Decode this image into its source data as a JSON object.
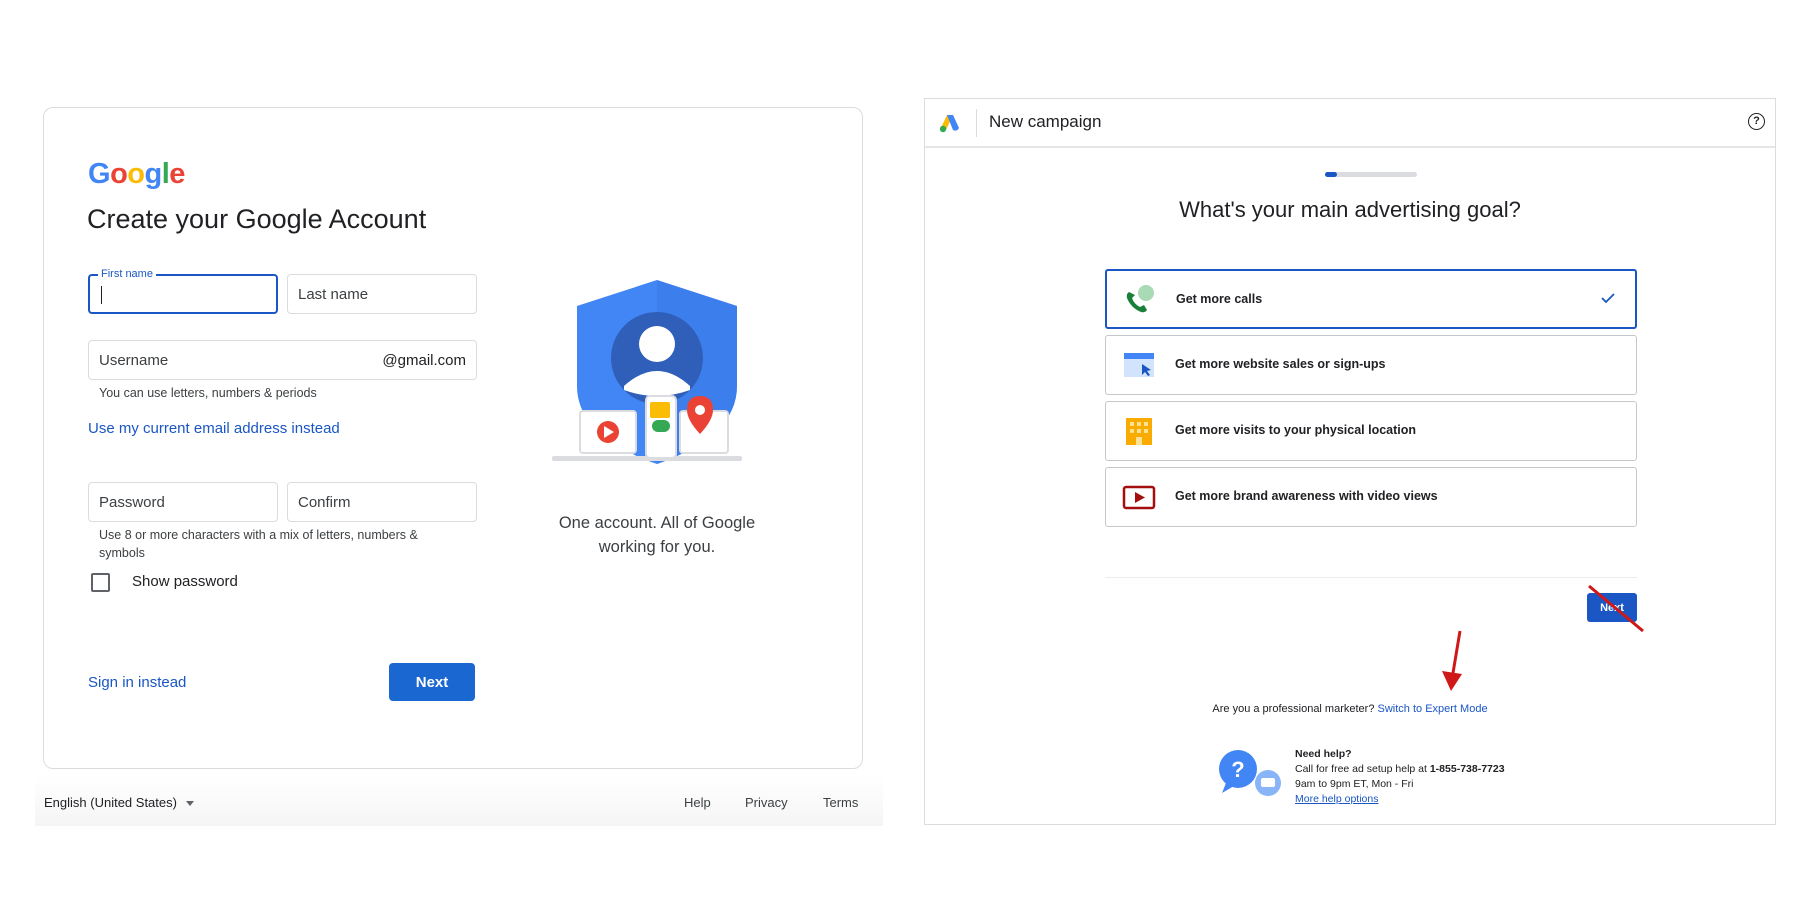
{
  "signup": {
    "logo_letters": [
      "G",
      "o",
      "o",
      "g",
      "l",
      "e"
    ],
    "title": "Create your Google Account",
    "first_name_label": "First name",
    "last_name_placeholder": "Last name",
    "username_placeholder": "Username",
    "username_suffix": "@gmail.com",
    "username_hint": "You can use letters, numbers & periods",
    "use_email_link": "Use my current email address instead",
    "password_placeholder": "Password",
    "confirm_placeholder": "Confirm",
    "password_hint_line1": "Use 8 or more characters with a mix of letters, numbers &",
    "password_hint_line2": "symbols",
    "show_password_label": "Show password",
    "sign_in_link": "Sign in instead",
    "next_label": "Next",
    "caption_line1": "One account. All of Google",
    "caption_line2": "working for you."
  },
  "footer": {
    "language": "English (United States)",
    "help": "Help",
    "privacy": "Privacy",
    "terms": "Terms"
  },
  "ads": {
    "title": "New campaign",
    "help_symbol": "?",
    "progress_fraction": 0.13,
    "question": "What's your main advertising goal?",
    "goals": [
      {
        "label": "Get more calls",
        "icon": "phone-icon",
        "selected": true
      },
      {
        "label": "Get more website sales or sign-ups",
        "icon": "website-icon",
        "selected": false
      },
      {
        "label": "Get more visits to your physical location",
        "icon": "building-icon",
        "selected": false
      },
      {
        "label": "Get more brand awareness with video views",
        "icon": "video-icon",
        "selected": false
      }
    ],
    "next_label": "Next",
    "pro_question": "Are you a professional marketer?",
    "expert_link": "Switch to Expert Mode",
    "need_help": "Need help?",
    "call_text": "Call for free ad setup help at",
    "phone": "1-855-738-7723",
    "hours": "9am to 9pm ET, Mon - Fri",
    "more_help": "More help options"
  },
  "colors": {
    "google_blue": "#4285F4",
    "google_red": "#EA4335",
    "google_yellow": "#FBBC05",
    "google_green": "#34A853",
    "primary_button": "#1a67d2",
    "link": "#1a56c4",
    "annotation_red": "#d01818"
  }
}
